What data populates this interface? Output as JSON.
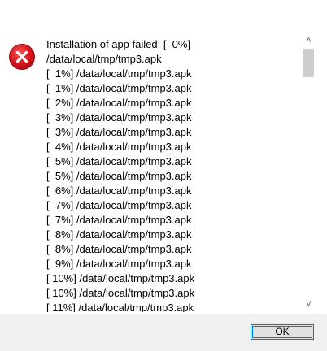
{
  "dialog": {
    "lines": [
      "Installation of app failed: [  0%]",
      "/data/local/tmp/tmp3.apk",
      "[  1%] /data/local/tmp/tmp3.apk",
      "[  1%] /data/local/tmp/tmp3.apk",
      "[  2%] /data/local/tmp/tmp3.apk",
      "[  3%] /data/local/tmp/tmp3.apk",
      "[  3%] /data/local/tmp/tmp3.apk",
      "[  4%] /data/local/tmp/tmp3.apk",
      "[  5%] /data/local/tmp/tmp3.apk",
      "[  5%] /data/local/tmp/tmp3.apk",
      "[  6%] /data/local/tmp/tmp3.apk",
      "[  7%] /data/local/tmp/tmp3.apk",
      "[  7%] /data/local/tmp/tmp3.apk",
      "[  8%] /data/local/tmp/tmp3.apk",
      "[  8%] /data/local/tmp/tmp3.apk",
      "[  9%] /data/local/tmp/tmp3.apk",
      "[ 10%] /data/local/tmp/tmp3.apk",
      "[ 10%] /data/local/tmp/tmp3.apk",
      "[ 11%] /data/local/tmp/tmp3.apk"
    ],
    "icon": "error-icon",
    "icon_color": "#e81123",
    "scroll_up_glyph": "˄",
    "scroll_down_glyph": "˅"
  },
  "footer": {
    "ok_label": "OK",
    "accent_color": "#0078d7"
  }
}
